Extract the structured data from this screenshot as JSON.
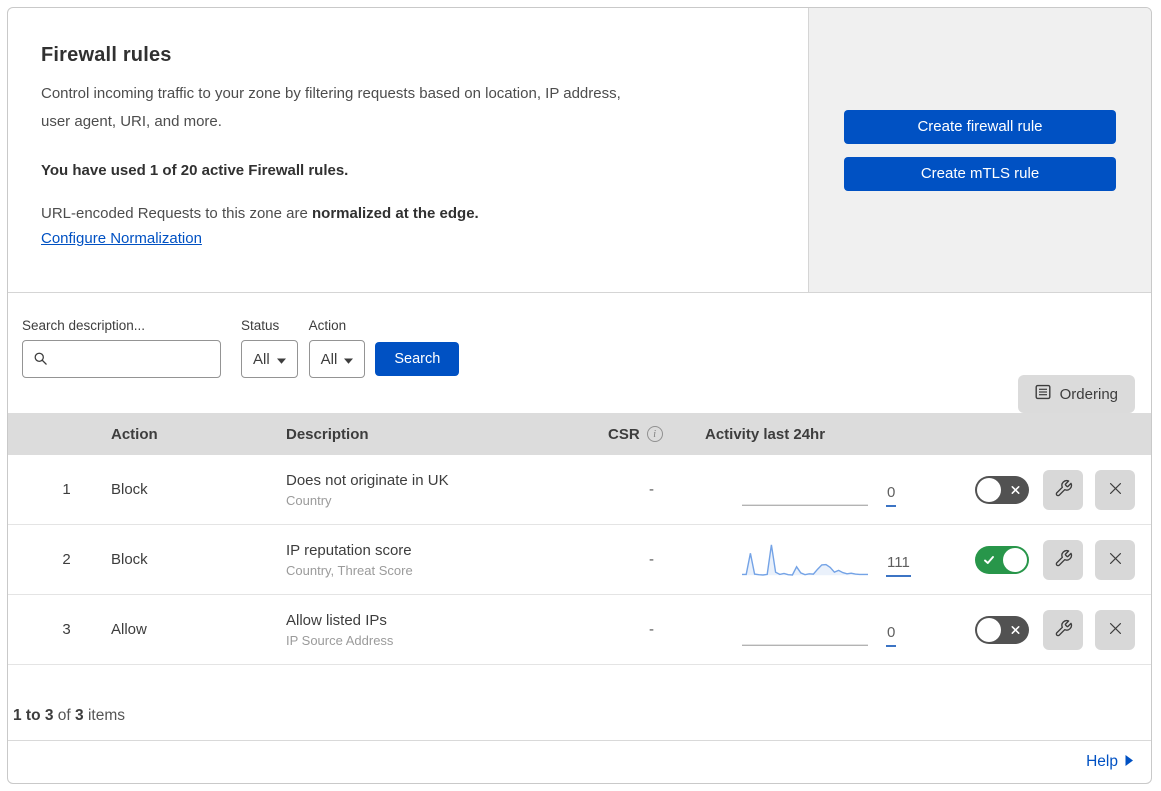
{
  "intro": {
    "title": "Firewall rules",
    "description_line1": "Control incoming traffic to your zone by filtering requests based on location, IP address,",
    "description_line2": "user agent, URI, and more.",
    "usage_bold": "You have used 1 of 20 active Firewall rules.",
    "normalization_prefix": "URL-encoded Requests to this zone are ",
    "normalization_bold": "normalized at the edge.",
    "configure_link": "Configure Normalization"
  },
  "cta": {
    "create_firewall_rule": "Create firewall rule",
    "create_mtls_rule": "Create mTLS rule"
  },
  "filters": {
    "search_label": "Search description...",
    "search_value": "",
    "status_label": "Status",
    "status_value": "All",
    "action_label": "Action",
    "action_value": "All",
    "search_button": "Search",
    "ordering_button": "Ordering"
  },
  "table": {
    "headers": {
      "action": "Action",
      "description": "Description",
      "csr": "CSR",
      "activity": "Activity last 24hr"
    },
    "csr_info_glyph": "i",
    "rows": [
      {
        "priority": "1",
        "action": "Block",
        "description": "Does not originate in UK",
        "criteria": "Country",
        "csr": "-",
        "count": "0",
        "enabled": false,
        "sparkline": [
          0,
          0
        ]
      },
      {
        "priority": "2",
        "action": "Block",
        "description": "IP reputation score",
        "criteria": "Country, Threat Score",
        "csr": "-",
        "count": "111",
        "enabled": true,
        "sparkline": [
          3,
          3,
          72,
          4,
          2,
          1,
          3,
          100,
          10,
          3,
          6,
          2,
          1,
          28,
          8,
          2,
          5,
          4,
          20,
          34,
          35,
          26,
          10,
          16,
          9,
          5,
          7,
          4,
          3,
          3,
          3
        ]
      },
      {
        "priority": "3",
        "action": "Allow",
        "description": "Allow listed IPs",
        "criteria": "IP Source Address",
        "csr": "-",
        "count": "0",
        "enabled": false,
        "sparkline": [
          0,
          0
        ]
      }
    ]
  },
  "footer": {
    "range_bold": "1 to 3",
    "of_text": " of ",
    "total_bold": "3",
    "items_text": " items"
  },
  "help": {
    "label": "Help"
  },
  "colors": {
    "accent_blue": "#0051c3",
    "link_blue": "#0051c3",
    "toggle_on_green": "#28964a",
    "toggle_off_gray": "#525252",
    "spark_line_blue": "#74a3e6",
    "spark_flat_gray": "#b3b3b3",
    "count_underline_blue": "#3c74c4",
    "header_bg": "#dcdcdc",
    "panel_bg": "#f0f0f0",
    "button_gray_bg": "#d8d8d8"
  }
}
